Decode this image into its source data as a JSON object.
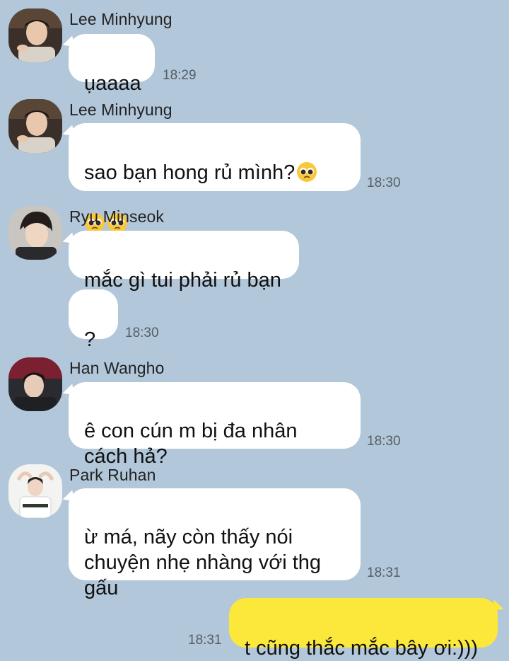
{
  "messages": [
    {
      "sender": "Lee Minhyung",
      "lines": [
        "ụaaaa"
      ],
      "time": "18:29"
    },
    {
      "sender": "Lee Minhyung",
      "line1": "sao bạn hong rủ mình?",
      "time": "18:30"
    },
    {
      "sender": "Ryu Minseok",
      "text1": "mắc gì tui phải rủ bạn",
      "text2": "?",
      "time": "18:30"
    },
    {
      "sender": "Han Wangho",
      "text": "ê con cún m bị đa nhân\ncách hả?",
      "time": "18:30"
    },
    {
      "sender": "Park Ruhan",
      "text": "ừ má, nãy còn thấy nói\nchuyện nhẹ nhàng với thg\ngấu",
      "time": "18:31"
    }
  ],
  "outgoing": {
    "text": "t cũng thắc mắc bây ơi:)))",
    "time": "18:31"
  },
  "emoji": {
    "name": "pleading-face-emoji"
  },
  "colors": {
    "background": "#b2c7da",
    "incoming_bubble": "#ffffff",
    "outgoing_bubble": "#fce83a"
  }
}
